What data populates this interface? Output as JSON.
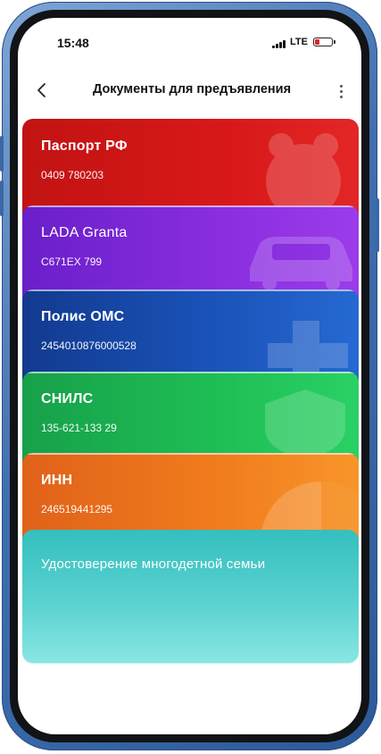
{
  "status_bar": {
    "time": "15:48",
    "network": "LTE"
  },
  "header": {
    "title": "Документы для предъявления"
  },
  "cards": [
    {
      "title": "Паспорт РФ",
      "number": "0409 780203",
      "color": "#d81818"
    },
    {
      "title": "LADA Granta",
      "number": "С671ЕХ 799",
      "color": "#8a2ee0"
    },
    {
      "title": "Полис ОМС",
      "number": "2454010876000528",
      "color": "#1a52b8"
    },
    {
      "title": "СНИЛС",
      "number": "135-621-133 29",
      "color": "#1fbf55"
    },
    {
      "title": "ИНН",
      "number": "246519441295",
      "color": "#f07a1c"
    },
    {
      "title": "Удостоверение многодетной семьи",
      "color": "#5ad2d0"
    }
  ],
  "icons": {
    "back": "chevron-left-icon",
    "more": "more-vertical-icon",
    "battery_color": "#e52323"
  }
}
